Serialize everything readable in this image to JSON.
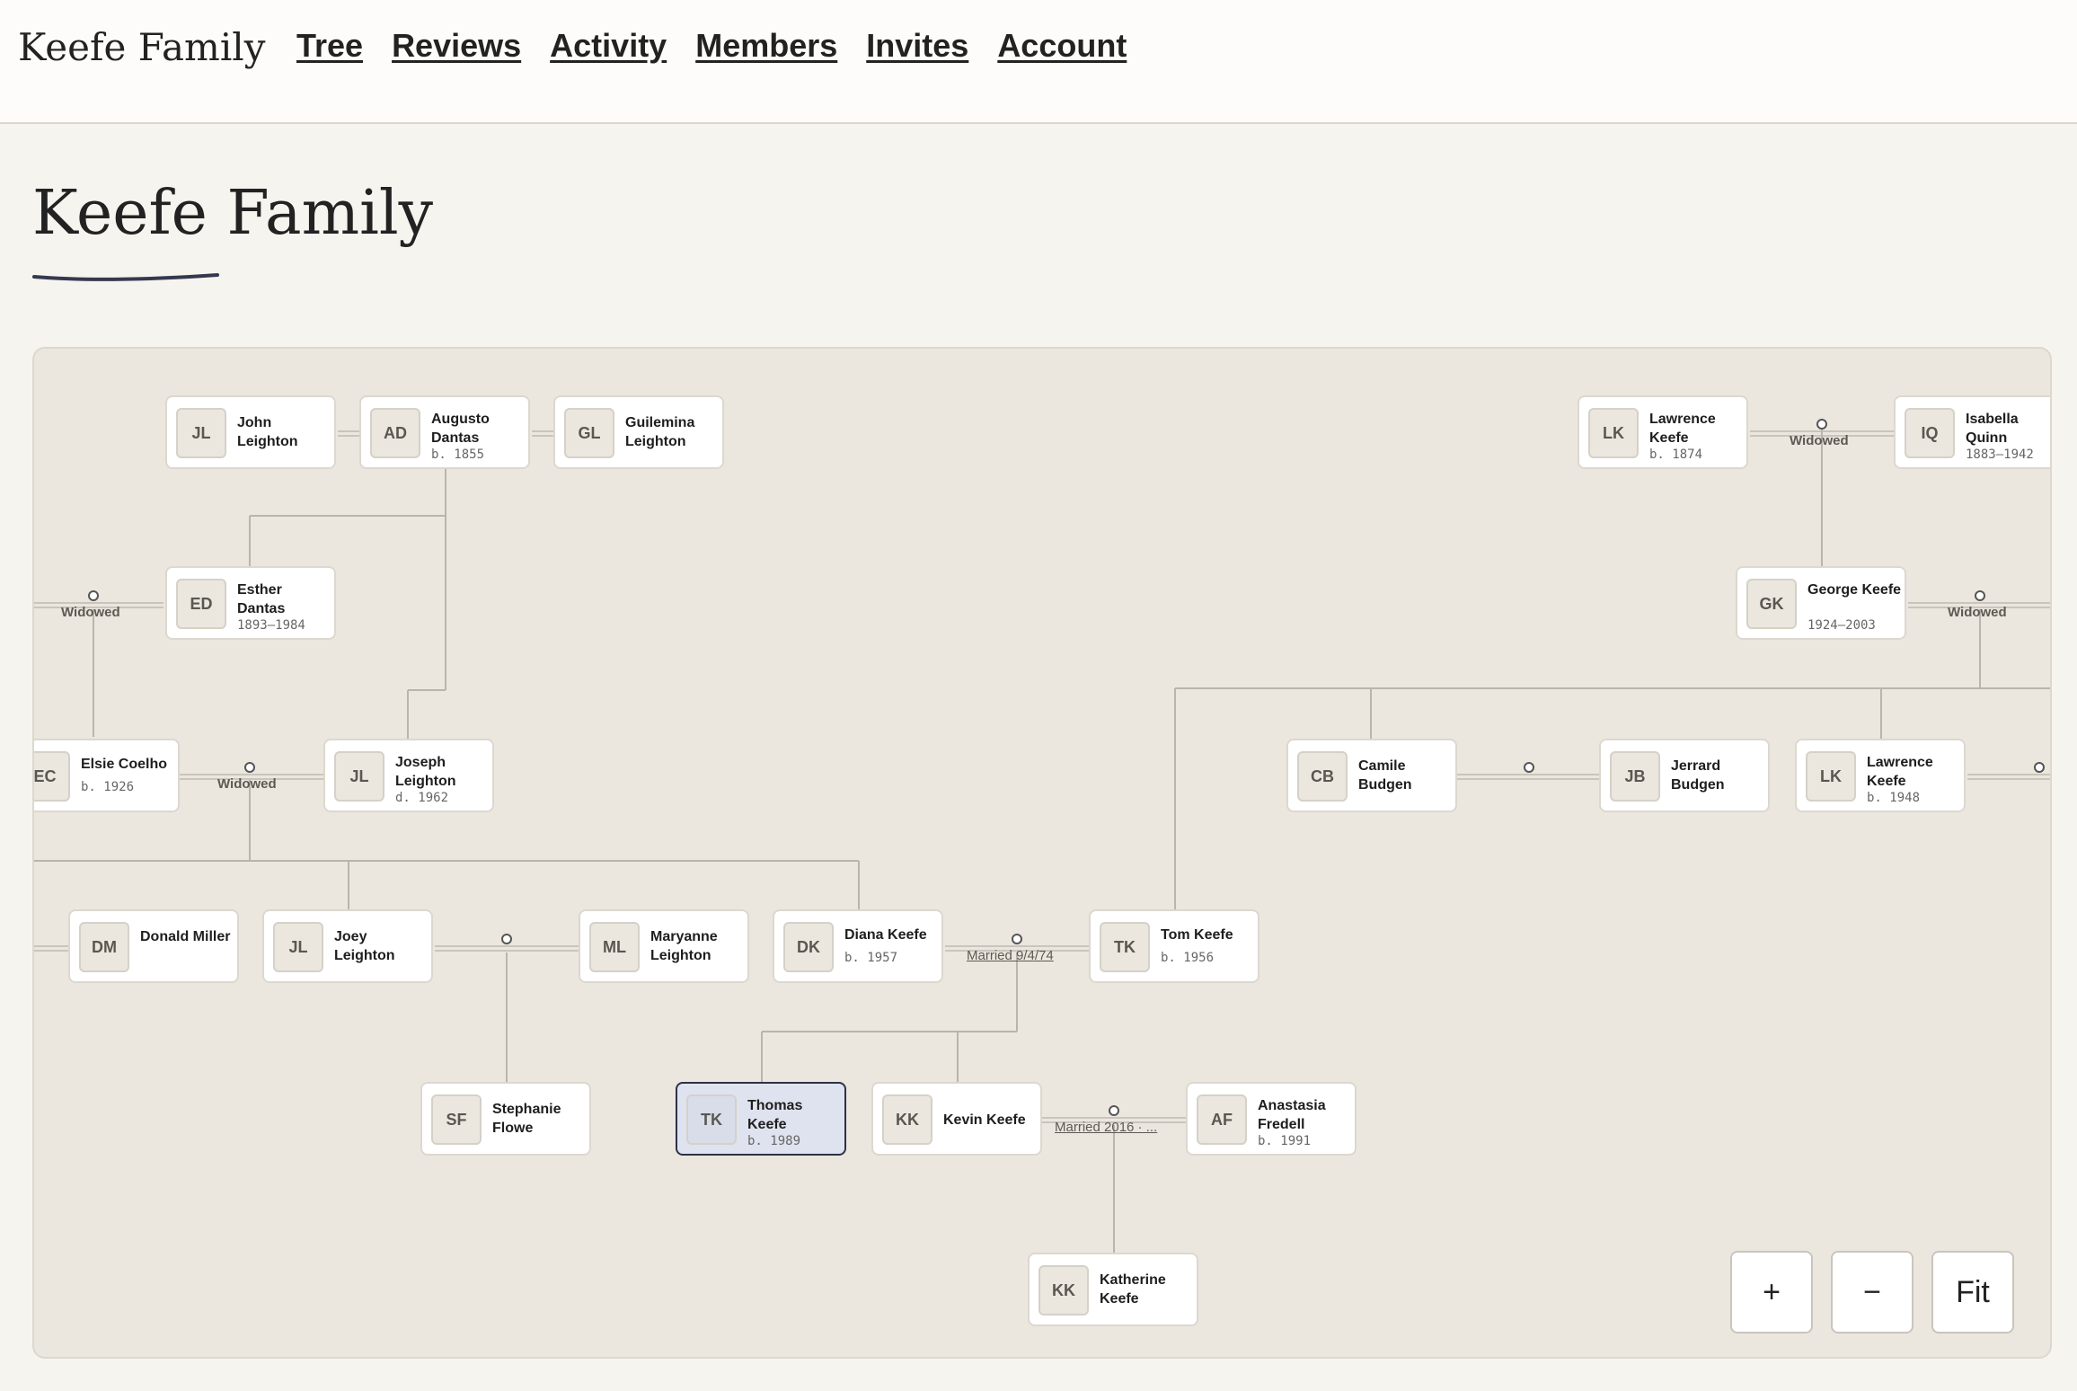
{
  "app": {
    "brand": "Keefe Family"
  },
  "nav": [
    "Tree",
    "Reviews",
    "Activity",
    "Members",
    "Invites",
    "Account"
  ],
  "page": {
    "title": "Keefe Family"
  },
  "people": [
    {
      "initials": "JL",
      "name": "John Leighton",
      "dates": ""
    },
    {
      "initials": "AD",
      "name": "Augusto Dantas",
      "dates": "b. 1855"
    },
    {
      "initials": "GL",
      "name": "Guilemina Leighton",
      "dates": ""
    },
    {
      "initials": "LK",
      "name": "Lawrence Keefe",
      "dates": "b. 1874"
    },
    {
      "initials": "IQ",
      "name": "Isabella Quinn",
      "dates": "1883–1942"
    },
    {
      "initials": "ED",
      "name": "Esther Dantas",
      "dates": "1893–1984"
    },
    {
      "initials": "GK",
      "name": "George Keefe",
      "dates": "1924–2003"
    },
    {
      "initials": "EC",
      "name": "Elsie Coelho",
      "dates": "b. 1926"
    },
    {
      "initials": "JL",
      "name": "Joseph Leighton",
      "dates": "d. 1962"
    },
    {
      "initials": "CB",
      "name": "Camile Budgen",
      "dates": ""
    },
    {
      "initials": "JB",
      "name": "Jerrard Budgen",
      "dates": ""
    },
    {
      "initials": "LK",
      "name": "Lawrence Keefe",
      "dates": "b. 1948"
    },
    {
      "initials": "DM",
      "name": "Donald Miller",
      "dates": ""
    },
    {
      "initials": "JL",
      "name": "Joey Leighton",
      "dates": ""
    },
    {
      "initials": "ML",
      "name": "Maryanne Leighton",
      "dates": ""
    },
    {
      "initials": "DK",
      "name": "Diana Keefe",
      "dates": "b. 1957"
    },
    {
      "initials": "TK",
      "name": "Tom Keefe",
      "dates": "b. 1956"
    },
    {
      "initials": "SF",
      "name": "Stephanie Flowe",
      "dates": ""
    },
    {
      "initials": "TK",
      "name": "Thomas Keefe",
      "dates": "b. 1989"
    },
    {
      "initials": "KK",
      "name": "Kevin Keefe",
      "dates": ""
    },
    {
      "initials": "AF",
      "name": "Anastasia Fredell",
      "dates": "b. 1991"
    },
    {
      "initials": "KK",
      "name": "Katherine Keefe",
      "dates": ""
    }
  ],
  "relationships": {
    "widowed": "Widowed",
    "diana_tom": "Married 9/4/74",
    "kevin_anastasia": "Married 2016 · ..."
  },
  "zoom_controls": {
    "zoom_in": "+",
    "zoom_out": "−",
    "fit": "Fit"
  }
}
